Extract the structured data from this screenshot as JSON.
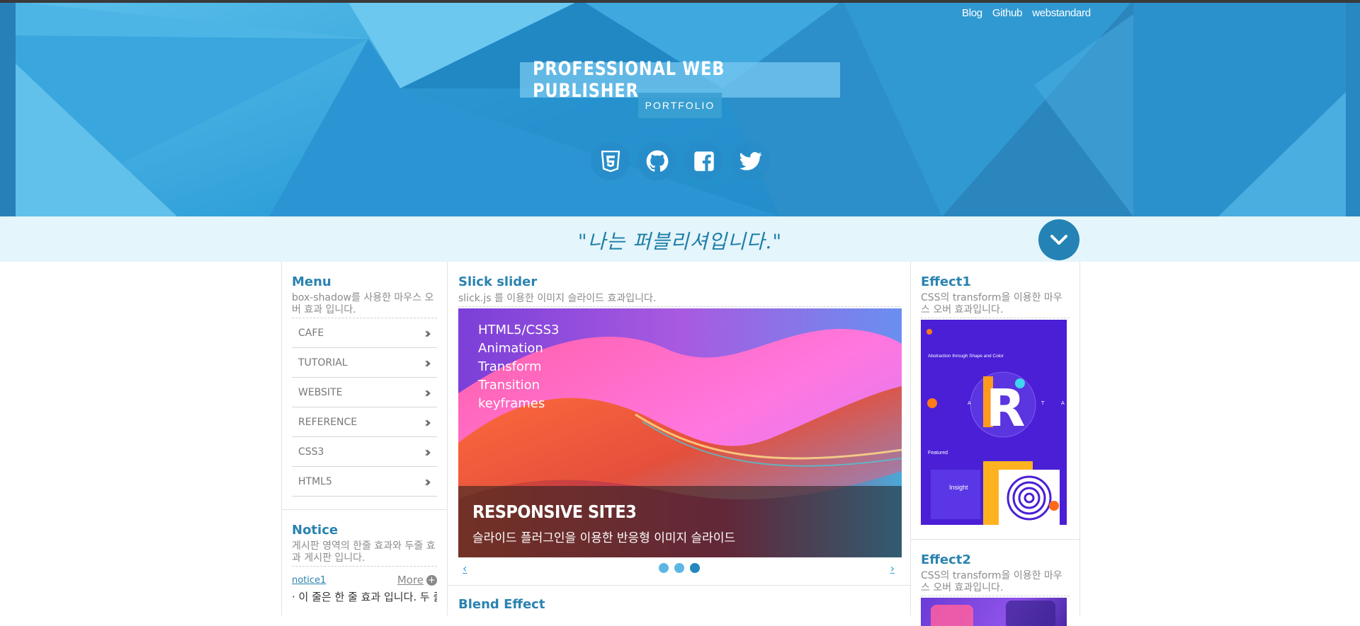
{
  "header": {
    "nav": [
      "Blog",
      "Github",
      "webstandard"
    ],
    "title": "PROFESSIONAL WEB PUBLISHER",
    "subtitle": "PORTFOLIO",
    "social_icons": [
      "html5-icon",
      "github-icon",
      "facebook-icon",
      "twitter-icon"
    ]
  },
  "quote": "\"나는 퍼블리셔입니다.\"",
  "menu": {
    "title": "Menu",
    "desc": "box-shadow를 사용한 마우스 오버 효과 입니다.",
    "items": [
      "CAFE",
      "TUTORIAL",
      "WEBSITE",
      "REFERENCE",
      "CSS3",
      "HTML5"
    ]
  },
  "notice": {
    "title": "Notice",
    "desc": "게시판 영역의 한줄 효과와 두줄 효과 게시판 입니다.",
    "tab": "notice1",
    "more": "More",
    "item": "이 줄은 한 줄 효과 입니다. 두 줄도 가능합니다"
  },
  "slick": {
    "title": "Slick slider",
    "desc": "slick.js 를 이용한 이미지 슬라이드 효과입니다.",
    "features": [
      "HTML5/CSS3",
      "Animation",
      "Transform",
      "Transition",
      "keyframes"
    ],
    "caption_title": "RESPONSIVE SITE3",
    "caption_desc": "슬라이드 플러그인을 이용한 반응형 이미지 슬라이드",
    "prev": "‹",
    "next": "›",
    "active_dot": 3,
    "dot_count": 3
  },
  "blend": {
    "title": "Blend Effect"
  },
  "effect1": {
    "title": "Effect1",
    "desc": "CSS의 transform을 이용한 마우스 오버 효과입니다.",
    "image_headline": "Abstraction through Shape and Color",
    "image_letter": "R",
    "image_letters": [
      "A",
      "T",
      "A"
    ],
    "image_label": "Featured",
    "image_label2": "Insight"
  },
  "effect2": {
    "title": "Effect2",
    "desc": "CSS의 transform을 이용한 마우스 오버 효과입니다."
  },
  "colors": {
    "accent": "#2a83b0",
    "header_blue": "#2f9fd9",
    "quote_bg": "#e4f5fb"
  }
}
